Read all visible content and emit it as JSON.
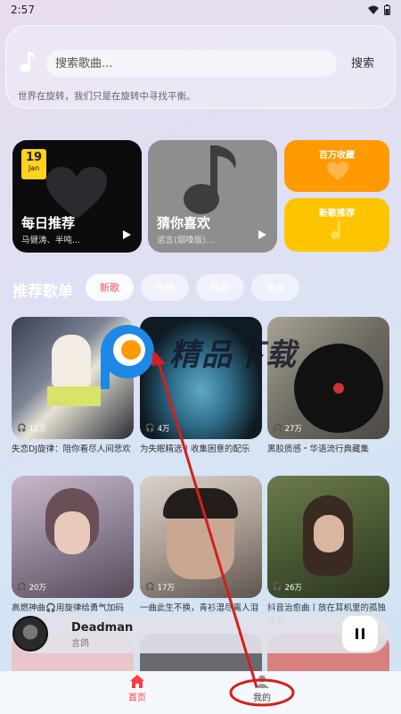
{
  "status": {
    "time": "2:57"
  },
  "search": {
    "placeholder": "搜索歌曲...",
    "button": "搜索"
  },
  "slogan": "世界在旋转，我们只是在旋转中寻找平衡。",
  "features": {
    "daily": {
      "day": "19",
      "month": "Jan",
      "title": "每日推荐",
      "subtitle": "马健涛、半吨..."
    },
    "guess": {
      "title": "猜你喜欢",
      "subtitle": "诺言(烟嗓版)..."
    },
    "million": {
      "title": "百万收藏"
    },
    "new": {
      "title": "新歌推荐"
    }
  },
  "section": {
    "title": "推荐歌单",
    "tags": [
      "新歌",
      "热榜",
      "抖音",
      "更多"
    ]
  },
  "playlists": [
    {
      "count": "12万",
      "title": "失恋DJ旋律：陪你看尽人间悲欢"
    },
    {
      "count": "4万",
      "title": "为失眠精选丨收集困意的配乐"
    },
    {
      "count": "27万",
      "title": "黑胶质感・华语流行典藏集"
    },
    {
      "count": "20万",
      "title": "高燃神曲🎧用旋律给勇气加码"
    },
    {
      "count": "17万",
      "title": "一曲此生不换，青衫湿尽离人泪"
    },
    {
      "count": "26万",
      "title": "抖音治愈曲丨放在耳机里的孤独疗愈"
    }
  ],
  "player": {
    "title": "Deadman",
    "subtitle": "言鸽"
  },
  "nav": {
    "home": "首页",
    "mine": "我的"
  },
  "watermark": "精品下载",
  "colors": {
    "accent": "#ff3b47",
    "orange": "#ff9a02",
    "yellow": "#ffc400"
  }
}
